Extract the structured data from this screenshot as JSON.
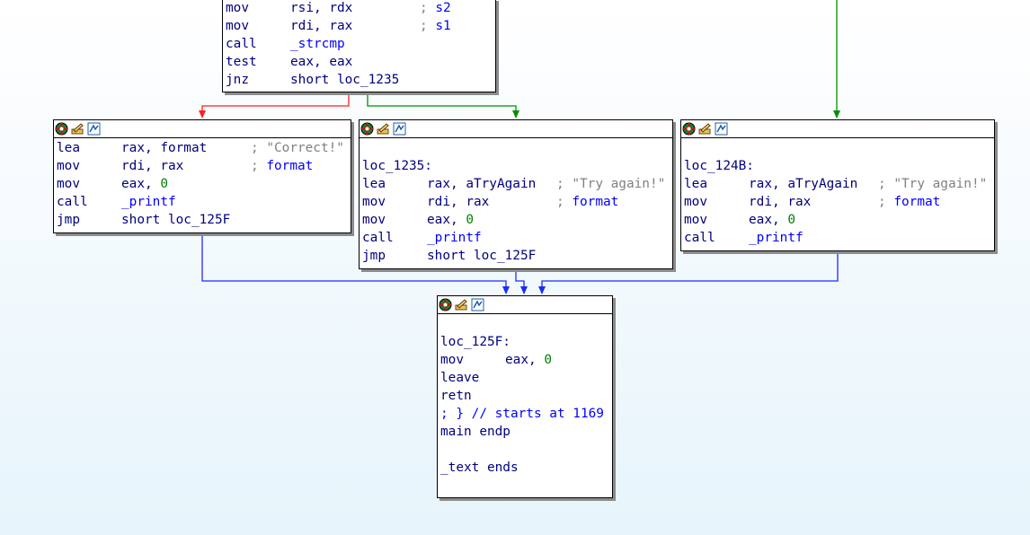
{
  "colors": {
    "true_edge": "#009000",
    "false_edge": "#ff2020",
    "jump_edge": "#1a2bff",
    "mnemonic": "#000080",
    "number": "#008000",
    "comment": "#808080",
    "symbol": "#0000ff"
  },
  "toolbar_icons": [
    "graph-color-icon",
    "rename-icon",
    "switch-view-icon"
  ],
  "blocks": {
    "top": {
      "lines": [
        {
          "mn": "mov",
          "op": "rsi, rdx",
          "cmt": ";",
          "sym": "s2"
        },
        {
          "mn": "mov",
          "op": "rdi, rax",
          "cmt": ";",
          "sym": "s1"
        },
        {
          "mn": "call",
          "op": "_strcmp"
        },
        {
          "mn": "test",
          "op": "eax, eax"
        },
        {
          "mn": "jnz",
          "op": "short loc_1235"
        }
      ]
    },
    "correct": {
      "lines": [
        {
          "mn": "lea",
          "op": "rax, format",
          "cmt": "; \"Correct!\""
        },
        {
          "mn": "mov",
          "op": "rdi, rax",
          "cmt": ";",
          "sym": "format"
        },
        {
          "mn": "mov",
          "op": "eax, ",
          "num": "0"
        },
        {
          "mn": "call",
          "op": "_printf"
        },
        {
          "mn": "jmp",
          "op": "short loc_125F"
        }
      ]
    },
    "loc1235": {
      "label": "loc_1235:",
      "lines": [
        {
          "mn": "lea",
          "op": "rax, aTryAgain",
          "cmt": "; \"Try again!\""
        },
        {
          "mn": "mov",
          "op": "rdi, rax",
          "cmt": ";",
          "sym": "format"
        },
        {
          "mn": "mov",
          "op": "eax, ",
          "num": "0"
        },
        {
          "mn": "call",
          "op": "_printf"
        },
        {
          "mn": "jmp",
          "op": "short loc_125F"
        }
      ]
    },
    "loc124b": {
      "label": "loc_124B:",
      "lines": [
        {
          "mn": "lea",
          "op": "rax, aTryAgain",
          "cmt": "; \"Try again!\""
        },
        {
          "mn": "mov",
          "op": "rdi, rax",
          "cmt": ";",
          "sym": "format"
        },
        {
          "mn": "mov",
          "op": "eax, ",
          "num": "0"
        },
        {
          "mn": "call",
          "op": "_printf"
        }
      ]
    },
    "loc125f": {
      "label": "loc_125F:",
      "lines": [
        {
          "mn": "mov",
          "op": "eax, ",
          "num": "0"
        },
        {
          "mn": "leave"
        },
        {
          "mn": "retn"
        }
      ],
      "footer": [
        "; } // starts at 1169",
        "main endp",
        "",
        "_text ends"
      ]
    }
  }
}
